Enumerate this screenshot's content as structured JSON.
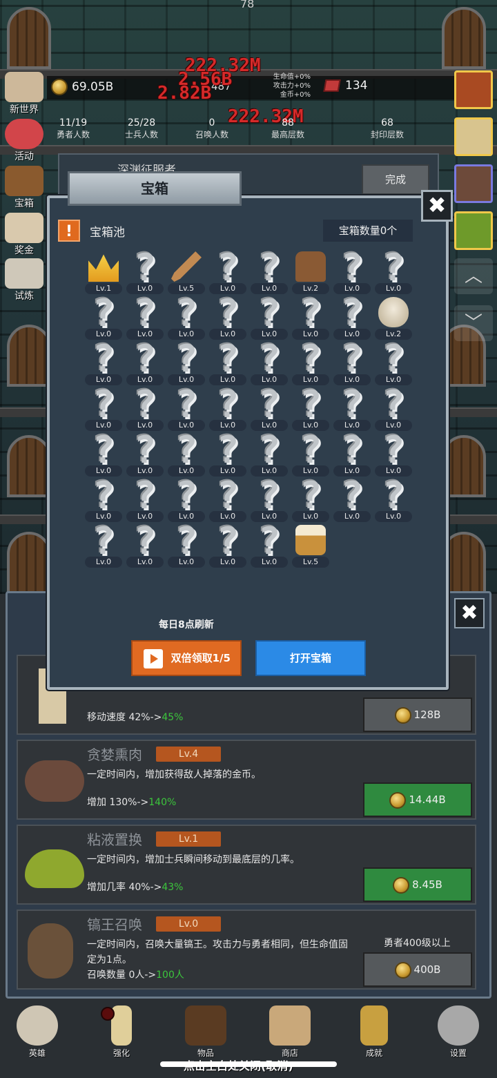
{
  "top_number": "78",
  "hud": {
    "gold": "69.05B",
    "power": "487",
    "bonus_hp": "生命值+0%",
    "bonus_atk": "攻击力+0%",
    "bonus_gold": "金币+0%",
    "gems": "134"
  },
  "damage_texts": [
    "222.32M",
    "2.56B",
    "2.82B",
    "222.32M"
  ],
  "stats": [
    {
      "value": "11/19",
      "label": "勇者人数"
    },
    {
      "value": "25/28",
      "label": "士兵人数"
    },
    {
      "value": "0",
      "label": "召唤人数"
    },
    {
      "value": "88",
      "label": "最高层数"
    },
    {
      "value": "68",
      "label": "封印层数"
    }
  ],
  "side_menu": [
    "新世界",
    "活动",
    "宝箱",
    "奖金",
    "试炼"
  ],
  "quest": {
    "title": "深渊征服者",
    "done_label": "完成"
  },
  "modal": {
    "tab_title": "宝箱",
    "close_label": "✖",
    "warn_glyph": "!",
    "pool_title": "宝箱池",
    "chest_count": "宝箱数量0个",
    "refresh_text": "每日8点刷新",
    "double_label": "双倍领取1/5",
    "open_label": "打开宝箱"
  },
  "chest_items": [
    {
      "type": "crown",
      "lv": "Lv.1"
    },
    {
      "type": "unknown",
      "lv": "Lv.0"
    },
    {
      "type": "sword",
      "lv": "Lv.5"
    },
    {
      "type": "unknown",
      "lv": "Lv.0"
    },
    {
      "type": "unknown",
      "lv": "Lv.0"
    },
    {
      "type": "armor",
      "lv": "Lv.2"
    },
    {
      "type": "unknown",
      "lv": "Lv.0"
    },
    {
      "type": "unknown",
      "lv": "Lv.0"
    },
    {
      "type": "unknown",
      "lv": "Lv.0"
    },
    {
      "type": "unknown",
      "lv": "Lv.0"
    },
    {
      "type": "unknown",
      "lv": "Lv.0"
    },
    {
      "type": "unknown",
      "lv": "Lv.0"
    },
    {
      "type": "unknown",
      "lv": "Lv.0"
    },
    {
      "type": "unknown",
      "lv": "Lv.0"
    },
    {
      "type": "unknown",
      "lv": "Lv.0"
    },
    {
      "type": "bowl",
      "lv": "Lv.2"
    },
    {
      "type": "unknown",
      "lv": "Lv.0"
    },
    {
      "type": "unknown",
      "lv": "Lv.0"
    },
    {
      "type": "unknown",
      "lv": "Lv.0"
    },
    {
      "type": "unknown",
      "lv": "Lv.0"
    },
    {
      "type": "unknown",
      "lv": "Lv.0"
    },
    {
      "type": "unknown",
      "lv": "Lv.0"
    },
    {
      "type": "unknown",
      "lv": "Lv.0"
    },
    {
      "type": "unknown",
      "lv": "Lv.0"
    },
    {
      "type": "unknown",
      "lv": "Lv.0"
    },
    {
      "type": "unknown",
      "lv": "Lv.0"
    },
    {
      "type": "unknown",
      "lv": "Lv.0"
    },
    {
      "type": "unknown",
      "lv": "Lv.0"
    },
    {
      "type": "unknown",
      "lv": "Lv.0"
    },
    {
      "type": "unknown",
      "lv": "Lv.0"
    },
    {
      "type": "unknown",
      "lv": "Lv.0"
    },
    {
      "type": "unknown",
      "lv": "Lv.0"
    },
    {
      "type": "unknown",
      "lv": "Lv.0"
    },
    {
      "type": "unknown",
      "lv": "Lv.0"
    },
    {
      "type": "unknown",
      "lv": "Lv.0"
    },
    {
      "type": "unknown",
      "lv": "Lv.0"
    },
    {
      "type": "unknown",
      "lv": "Lv.0"
    },
    {
      "type": "unknown",
      "lv": "Lv.0"
    },
    {
      "type": "unknown",
      "lv": "Lv.0"
    },
    {
      "type": "unknown",
      "lv": "Lv.0"
    },
    {
      "type": "unknown",
      "lv": "Lv.0"
    },
    {
      "type": "unknown",
      "lv": "Lv.0"
    },
    {
      "type": "unknown",
      "lv": "Lv.0"
    },
    {
      "type": "unknown",
      "lv": "Lv.0"
    },
    {
      "type": "unknown",
      "lv": "Lv.0"
    },
    {
      "type": "unknown",
      "lv": "Lv.0"
    },
    {
      "type": "unknown",
      "lv": "Lv.0"
    },
    {
      "type": "unknown",
      "lv": "Lv.0"
    },
    {
      "type": "unknown",
      "lv": "Lv.0"
    },
    {
      "type": "unknown",
      "lv": "Lv.0"
    },
    {
      "type": "unknown",
      "lv": "Lv.0"
    },
    {
      "type": "unknown",
      "lv": "Lv.0"
    },
    {
      "type": "unknown",
      "lv": "Lv.0"
    },
    {
      "type": "beer",
      "lv": "Lv.5"
    }
  ],
  "upgrades": [
    {
      "name": "",
      "level": "",
      "desc": "",
      "stat_prefix": "移动速度 42%->",
      "stat_new": "45%",
      "price": "128B",
      "button": "gray",
      "requirement": ""
    },
    {
      "name": "贪婪熏肉",
      "level": "Lv.4",
      "desc": "一定时间内，增加获得敌人掉落的金币。",
      "stat_prefix": "增加 130%->",
      "stat_new": "140%",
      "price": "14.44B",
      "button": "green",
      "requirement": ""
    },
    {
      "name": "粘液置换",
      "level": "Lv.1",
      "desc": "一定时间内，增加士兵瞬间移动到最底层的几率。",
      "stat_prefix": "增加几率 40%->",
      "stat_new": "43%",
      "price": "8.45B",
      "button": "green",
      "requirement": ""
    },
    {
      "name": "镐王召唤",
      "level": "Lv.0",
      "desc": "一定时间内，召唤大量镐王。攻击力与勇者相同，但生命值固定为1点。",
      "stat_prefix": "召唤数量 0人->",
      "stat_new": "100人",
      "price": "400B",
      "button": "gray",
      "requirement": "勇者400级以上"
    }
  ],
  "nav": [
    "英雄",
    "强化",
    "物品",
    "商店",
    "成就",
    "设置"
  ],
  "close_hint": "点击空白处关闭(取消)",
  "colors": {
    "accent_orange": "#e06a22",
    "accent_blue": "#2b8ae6",
    "buy_green": "#2f8a3f",
    "damage_red": "#d52a2a"
  }
}
